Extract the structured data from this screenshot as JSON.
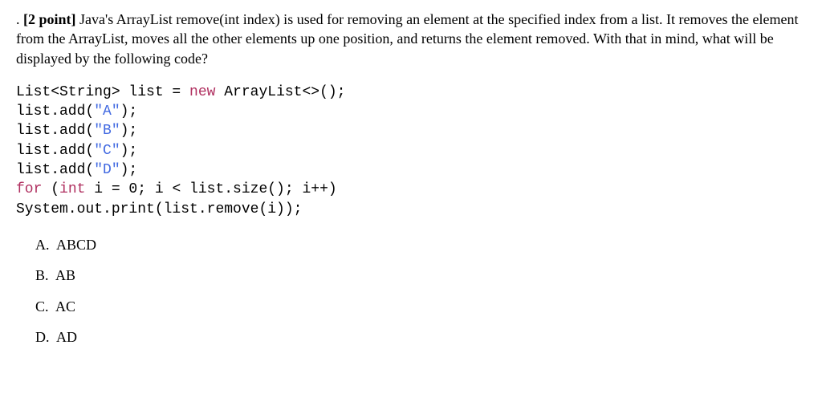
{
  "question": {
    "prefix": ". ",
    "points_label": "[2 point]",
    "text_1": " Java's ArrayList remove(int index) is used for removing an element at the specified index from a list. It removes the element from the ArrayList, moves all the other elements up one position, and returns the element removed. With that in mind, what will be displayed by the following code?"
  },
  "code": {
    "l1a": "List<String> list = ",
    "l1_kw": "new",
    "l1b": " ArrayList<>();",
    "l2a": "list.add(",
    "l2_str": "\"A\"",
    "l2b": ");",
    "l3a": "list.add(",
    "l3_str": "\"B\"",
    "l3b": ");",
    "l4a": "list.add(",
    "l4_str": "\"C\"",
    "l4b": ");",
    "l5a": "list.add(",
    "l5_str": "\"D\"",
    "l5b": ");",
    "l6_kw1": "for",
    "l6a": " (",
    "l6_kw2": "int",
    "l6b": " i = 0; i < list.size(); i++)",
    "l7": "System.out.print(list.remove(i));"
  },
  "options": [
    {
      "letter": "A.",
      "text": "ABCD"
    },
    {
      "letter": "B.",
      "text": "AB"
    },
    {
      "letter": "C.",
      "text": "AC"
    },
    {
      "letter": "D.",
      "text": "AD"
    }
  ]
}
